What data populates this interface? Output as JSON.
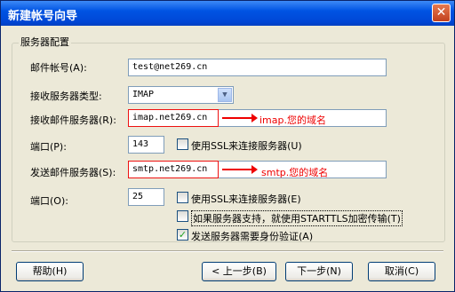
{
  "window": {
    "title": "新建帐号向导",
    "close": "✕"
  },
  "group_title": "服务器配置",
  "fields": {
    "account": {
      "label": "邮件帐号(A):",
      "value": "test@net269.cn"
    },
    "server_type": {
      "label": "接收服务器类型:",
      "value": "IMAP"
    },
    "incoming": {
      "label": "接收邮件服务器(R):",
      "value": "imap.net269.cn",
      "annotation": "imap.您的域名"
    },
    "incoming_port": {
      "label": "端口(P):",
      "value": "143",
      "ssl_label": "使用SSL来连接服务器(U)",
      "ssl_checked": false
    },
    "outgoing": {
      "label": "发送邮件服务器(S):",
      "value": "smtp.net269.cn",
      "annotation": "smtp.您的域名"
    },
    "outgoing_port": {
      "label": "端口(O):",
      "value": "25",
      "ssl_label": "使用SSL来连接服务器(E)",
      "ssl_checked": false
    },
    "starttls": {
      "label": "如果服务器支持，就使用STARTTLS加密传输(T)",
      "checked": false
    },
    "auth": {
      "label": "发送服务器需要身份验证(A)",
      "checked": true
    }
  },
  "buttons": {
    "help": "帮助(H)",
    "back": "< 上一步(B)",
    "next": "下一步(N)",
    "cancel": "取消(C)"
  },
  "colors": {
    "annotation": "#e00000",
    "titlebar": "#0054e3"
  }
}
